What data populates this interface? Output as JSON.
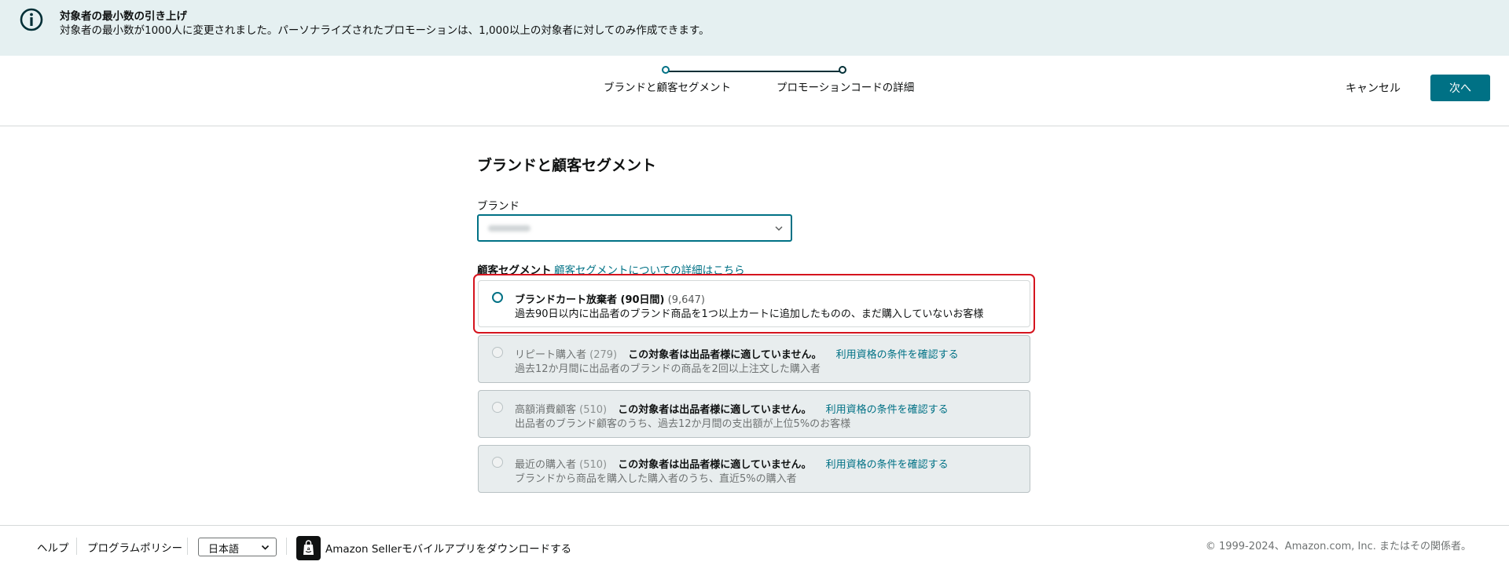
{
  "banner": {
    "icon": "info-icon",
    "title": "対象者の最小数の引き上げ",
    "message": "対象者の最小数が1000人に変更されました。パーソナライズされたプロモーションは、1,000以上の対象者に対してのみ作成できます。"
  },
  "header": {
    "steps": [
      {
        "label": "ブランドと顧客セグメント",
        "state": "current"
      },
      {
        "label": "プロモーションコードの詳細",
        "state": "upcoming"
      }
    ],
    "cancel_label": "キャンセル",
    "next_label": "次へ"
  },
  "main": {
    "section_title": "ブランドと顧客セグメント",
    "brand": {
      "label": "ブランド",
      "value_blurred": true
    },
    "segment": {
      "label": "顧客セグメント",
      "help_link": "顧客セグメントについての詳細はこちら",
      "options": [
        {
          "title": "ブランドカート放棄者 (90日間)",
          "count": "(9,647)",
          "description": "過去90日以内に出品者のブランド商品を1つ以上カートに追加したものの、まだ購入していないお客様",
          "enabled": true,
          "highlighted": true
        },
        {
          "title": "リピート購入者",
          "count": "(279)",
          "warning": "この対象者は出品者様に適していません。",
          "link": "利用資格の条件を確認する",
          "description": "過去12か月間に出品者のブランドの商品を2回以上注文した購入者",
          "enabled": false
        },
        {
          "title": "高額消費顧客",
          "count": "(510)",
          "warning": "この対象者は出品者様に適していません。",
          "link": "利用資格の条件を確認する",
          "description": "出品者のブランド顧客のうち、過去12か月間の支出額が上位5%のお客様",
          "enabled": false
        },
        {
          "title": "最近の購入者",
          "count": "(510)",
          "warning": "この対象者は出品者様に適していません。",
          "link": "利用資格の条件を確認する",
          "description": "ブランドから商品を購入した購入者のうち、直近5%の購入者",
          "enabled": false
        }
      ]
    }
  },
  "footer": {
    "help": "ヘルプ",
    "policy": "プログラムポリシー",
    "language": "日本語",
    "app_icon": "amazon-seller-app-icon",
    "app_text": "Amazon Sellerモバイルアプリをダウンロードする",
    "copyright": "© 1999-2024、Amazon.com, Inc. またはその関係者。"
  },
  "colors": {
    "accent": "#007185",
    "banner_bg": "#e5f0f1",
    "highlight": "#d5141e",
    "disabled_bg": "#e8edee"
  }
}
